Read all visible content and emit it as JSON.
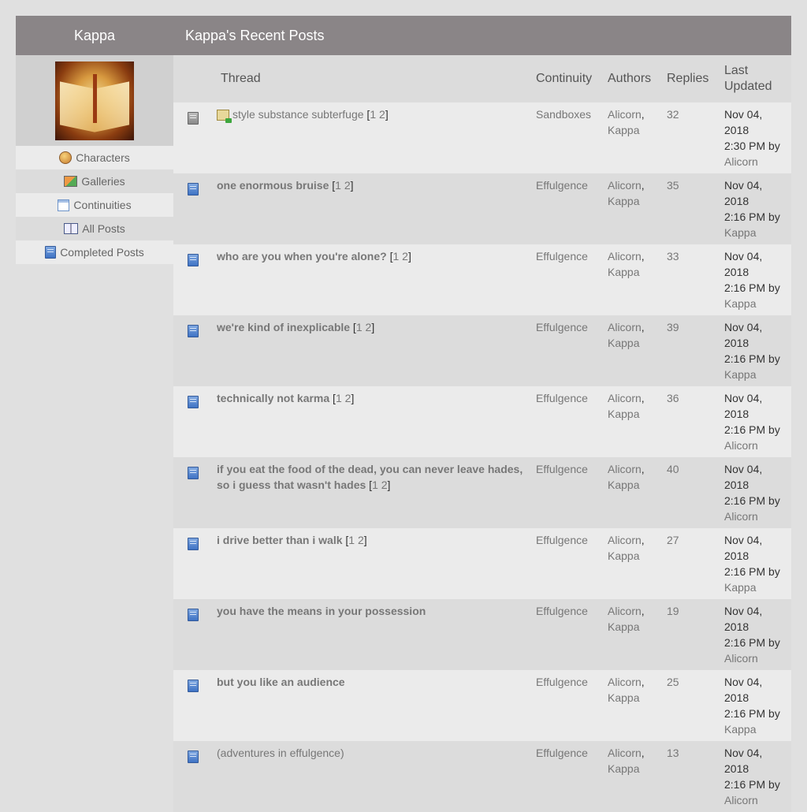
{
  "sidebar": {
    "username": "Kappa",
    "nav": [
      {
        "label": "Characters",
        "icon": "characters-icon"
      },
      {
        "label": "Galleries",
        "icon": "galleries-icon"
      },
      {
        "label": "Continuities",
        "icon": "continuities-icon"
      },
      {
        "label": "All Posts",
        "icon": "book-icon"
      },
      {
        "label": "Completed Posts",
        "icon": "completed-post-icon"
      }
    ]
  },
  "main": {
    "title": "Kappa's Recent Posts",
    "columns": {
      "thread": "Thread",
      "continuity": "Continuity",
      "authors": "Authors",
      "replies": "Replies",
      "last_updated_1": "Last",
      "last_updated_2": "Updated"
    },
    "posts": [
      {
        "title": "style substance subterfuge",
        "bold": false,
        "pages": [
          "1",
          "2"
        ],
        "continuity": "Sandboxes",
        "author1": "Alicorn",
        "author2": "Kappa",
        "replies": "32",
        "date": "Nov 04, 2018",
        "time": "2:30 PM by",
        "by": "Alicorn",
        "icon": "sandbox-post-icon"
      },
      {
        "title": "one enormous bruise",
        "bold": true,
        "pages": [
          "1",
          "2"
        ],
        "continuity": "Effulgence",
        "author1": "Alicorn",
        "author2": "Kappa",
        "replies": "35",
        "date": "Nov 04, 2018",
        "time": "2:16 PM by",
        "by": "Kappa",
        "icon": "post-icon"
      },
      {
        "title": "who are you when you're alone?",
        "bold": true,
        "pages": [
          "1",
          "2"
        ],
        "continuity": "Effulgence",
        "author1": "Alicorn",
        "author2": "Kappa",
        "replies": "33",
        "date": "Nov 04, 2018",
        "time": "2:16 PM by",
        "by": "Kappa",
        "icon": "post-icon"
      },
      {
        "title": "we're kind of inexplicable",
        "bold": true,
        "pages": [
          "1",
          "2"
        ],
        "continuity": "Effulgence",
        "author1": "Alicorn",
        "author2": "Kappa",
        "replies": "39",
        "date": "Nov 04, 2018",
        "time": "2:16 PM by",
        "by": "Kappa",
        "icon": "post-icon"
      },
      {
        "title": "technically not karma",
        "bold": true,
        "pages": [
          "1",
          "2"
        ],
        "continuity": "Effulgence",
        "author1": "Alicorn",
        "author2": "Kappa",
        "replies": "36",
        "date": "Nov 04, 2018",
        "time": "2:16 PM by",
        "by": "Alicorn",
        "icon": "post-icon"
      },
      {
        "title": "if you eat the food of the dead, you can never leave hades, so i guess that wasn't hades",
        "bold": true,
        "pages": [
          "1",
          "2"
        ],
        "continuity": "Effulgence",
        "author1": "Alicorn",
        "author2": "Kappa",
        "replies": "40",
        "date": "Nov 04, 2018",
        "time": "2:16 PM by",
        "by": "Alicorn",
        "icon": "post-icon"
      },
      {
        "title": "i drive better than i walk",
        "bold": true,
        "pages": [
          "1",
          "2"
        ],
        "continuity": "Effulgence",
        "author1": "Alicorn",
        "author2": "Kappa",
        "replies": "27",
        "date": "Nov 04, 2018",
        "time": "2:16 PM by",
        "by": "Kappa",
        "icon": "post-icon"
      },
      {
        "title": "you have the means in your possession",
        "bold": true,
        "pages": [],
        "continuity": "Effulgence",
        "author1": "Alicorn",
        "author2": "Kappa",
        "replies": "19",
        "date": "Nov 04, 2018",
        "time": "2:16 PM by",
        "by": "Alicorn",
        "icon": "post-icon"
      },
      {
        "title": "but you like an audience",
        "bold": true,
        "pages": [],
        "continuity": "Effulgence",
        "author1": "Alicorn",
        "author2": "Kappa",
        "replies": "25",
        "date": "Nov 04, 2018",
        "time": "2:16 PM by",
        "by": "Kappa",
        "icon": "post-icon"
      },
      {
        "title": "(adventures in effulgence)",
        "bold": false,
        "pages": [],
        "continuity": "Effulgence",
        "author1": "Alicorn",
        "author2": "Kappa",
        "replies": "13",
        "date": "Nov 04, 2018",
        "time": "2:16 PM by",
        "by": "Alicorn",
        "icon": "post-icon"
      }
    ]
  }
}
